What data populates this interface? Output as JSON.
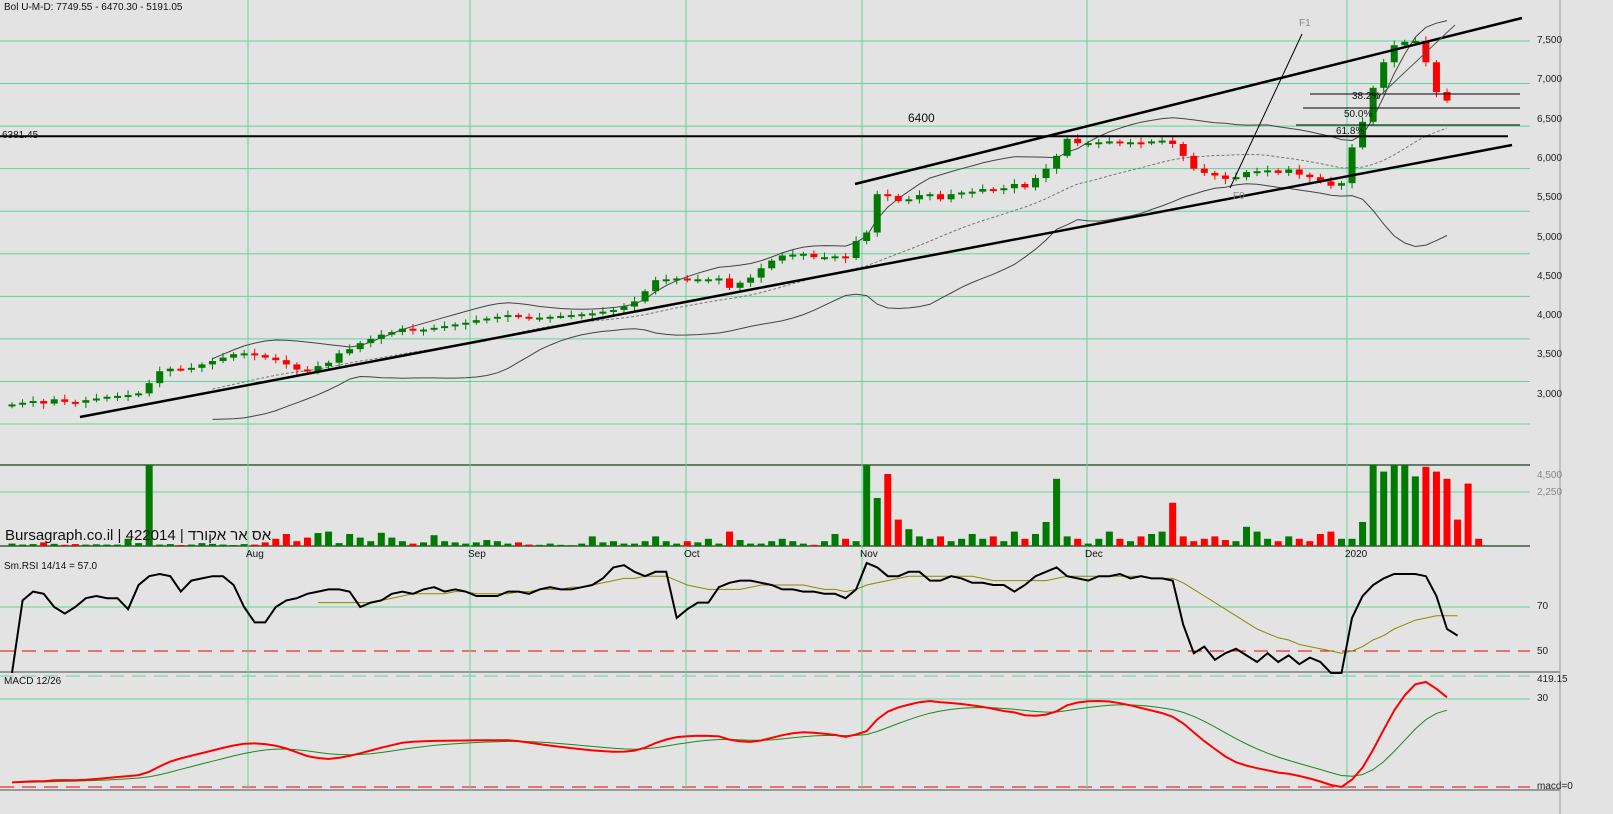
{
  "header": {
    "bollinger_label": "Bol U-M-D: 7749.55 - 6470.30 - 5191.05",
    "level_label": "6381.45"
  },
  "brand": "Bursagraph.co.il | 422014 | אס אר אקורד",
  "annotations": {
    "level": "6400",
    "fib_382": "38.2%",
    "fib_50": "50.0%",
    "fib_618": "61.8%",
    "f1": "F1",
    "f0": "F0"
  },
  "price_axis": [
    "7,500",
    "7,000",
    "6,500",
    "6,000",
    "5,500",
    "5,000",
    "4,500",
    "4,000",
    "3,500",
    "3,000"
  ],
  "volume_axis": [
    "4,500",
    "2,250"
  ],
  "rsi": {
    "label": "Sm.RSI 14/14 = 57.0",
    "axis": [
      "70",
      "50"
    ]
  },
  "macd": {
    "label": "MACD 12/26",
    "axis": [
      "419.15",
      "30",
      "macd=0"
    ]
  },
  "months": [
    "Aug",
    "Sep",
    "Oct",
    "Nov",
    "Dec",
    "2020"
  ],
  "colors": {
    "up": "#007a00",
    "down": "#ff0000",
    "grid": "#5fd49a",
    "bg": "#e3e3e3"
  },
  "chart_data": {
    "type": "candlestick",
    "title": "Bol U-M-D: 7749.55 - 6470.30 - 5191.05",
    "price_ylim": [
      2700,
      7800
    ],
    "horizontal_level": 6381.45,
    "closes": [
      3230,
      3250,
      3270,
      3240,
      3290,
      3260,
      3250,
      3280,
      3300,
      3320,
      3330,
      3340,
      3360,
      3480,
      3620,
      3650,
      3640,
      3660,
      3700,
      3740,
      3780,
      3820,
      3830,
      3810,
      3780,
      3750,
      3700,
      3640,
      3620,
      3680,
      3720,
      3830,
      3880,
      3950,
      4000,
      4050,
      4080,
      4120,
      4100,
      4110,
      4130,
      4150,
      4170,
      4190,
      4220,
      4240,
      4260,
      4280,
      4260,
      4250,
      4250,
      4260,
      4270,
      4280,
      4290,
      4300,
      4320,
      4340,
      4380,
      4440,
      4560,
      4690,
      4700,
      4710,
      4690,
      4700,
      4700,
      4710,
      4600,
      4660,
      4720,
      4830,
      4920,
      4980,
      4990,
      5000,
      4960,
      4960,
      4970,
      4950,
      5150,
      5250,
      5700,
      5680,
      5620,
      5640,
      5690,
      5700,
      5640,
      5700,
      5720,
      5730,
      5760,
      5750,
      5770,
      5820,
      5780,
      5890,
      6000,
      6150,
      6350,
      6300,
      6300,
      6310,
      6320,
      6300,
      6310,
      6300,
      6320,
      6330,
      6290,
      6150,
      6000,
      5950,
      5920,
      5880,
      5900,
      5960,
      5970,
      5980,
      5950,
      5990,
      5930,
      5900,
      5850,
      5800,
      5830,
      6250,
      6550,
      6950,
      7250,
      7450,
      7490,
      7500,
      7250,
      6900,
      6800
    ],
    "volumes": [
      100,
      60,
      80,
      150,
      90,
      50,
      80,
      60,
      70,
      60,
      60,
      300,
      120,
      4500,
      60,
      80,
      40,
      60,
      120,
      90,
      60,
      40,
      80,
      60,
      150,
      300,
      500,
      200,
      350,
      540,
      600,
      120,
      500,
      350,
      200,
      550,
      350,
      200,
      100,
      150,
      450,
      200,
      150,
      100,
      150,
      250,
      200,
      100,
      150,
      60,
      50,
      100,
      50,
      30,
      100,
      400,
      150,
      200,
      100,
      100,
      200,
      400,
      200,
      100,
      200,
      150,
      300,
      100,
      600,
      250,
      100,
      100,
      200,
      300,
      200,
      100,
      50,
      200,
      500,
      300,
      200,
      3800,
      2000,
      3000,
      1100,
      700,
      400,
      300,
      400,
      200,
      300,
      500,
      300,
      400,
      200,
      600,
      300,
      500,
      1000,
      2800,
      400,
      300,
      100,
      300,
      600,
      300,
      200,
      400,
      500,
      600,
      1800,
      400,
      200,
      300,
      400,
      250,
      200,
      800,
      600,
      300,
      200,
      400,
      300,
      200,
      500,
      600,
      300,
      300,
      1000,
      3600,
      3100,
      4100,
      4500,
      2900,
      3300,
      3100,
      2800,
      1100,
      2600,
      300
    ],
    "volume_ylim": [
      0,
      4500
    ],
    "rsi_levels": [
      70,
      50
    ],
    "rsi": [
      40,
      73,
      77,
      76,
      70,
      67,
      70,
      74,
      75,
      74,
      74,
      69,
      80,
      84,
      85,
      84,
      77,
      82,
      83,
      84,
      84,
      80,
      70,
      63,
      63,
      70,
      73,
      74,
      76,
      77,
      78,
      78,
      77,
      70,
      72,
      73,
      76,
      77,
      76,
      78,
      79,
      77,
      78,
      77,
      75,
      75,
      75,
      77,
      77,
      76,
      78,
      79,
      78,
      78,
      79,
      80,
      83,
      88,
      89,
      86,
      84,
      86,
      86,
      65,
      69,
      72,
      72,
      79,
      81,
      82,
      82,
      81,
      80,
      78,
      78,
      77,
      77,
      76,
      76,
      74,
      78,
      90,
      88,
      84,
      84,
      86,
      86,
      82,
      82,
      84,
      83,
      81,
      81,
      80,
      80,
      77,
      80,
      84,
      86,
      88,
      84,
      83,
      82,
      84,
      84,
      85,
      83,
      84,
      83,
      83,
      82,
      62,
      49,
      52,
      46,
      49,
      51,
      48,
      45,
      49,
      45,
      48,
      44,
      47,
      45,
      40,
      40,
      65,
      75,
      80,
      83,
      85,
      85,
      85,
      84,
      75,
      60,
      57
    ],
    "rsi_signal": [
      null,
      null,
      null,
      null,
      null,
      null,
      null,
      null,
      null,
      null,
      null,
      null,
      null,
      null,
      null,
      null,
      null,
      null,
      null,
      null,
      null,
      null,
      null,
      null,
      null,
      null,
      null,
      null,
      null,
      72,
      72,
      72,
      72,
      72,
      72,
      73,
      74,
      75,
      76,
      76,
      76,
      76,
      77,
      77,
      76,
      76,
      76,
      76,
      77,
      77,
      78,
      78,
      78,
      79,
      79,
      80,
      81,
      82,
      83,
      83,
      84,
      84,
      84,
      82,
      80,
      79,
      78,
      78,
      78,
      78,
      79,
      80,
      80,
      80,
      80,
      80,
      79,
      78,
      78,
      77,
      78,
      80,
      81,
      82,
      83,
      84,
      84,
      84,
      84,
      84,
      84,
      84,
      83,
      82,
      82,
      82,
      82,
      82,
      82,
      83,
      84,
      84,
      84,
      84,
      84,
      84,
      84,
      84,
      83,
      83,
      83,
      81,
      78,
      75,
      72,
      69,
      66,
      63,
      60,
      58,
      56,
      55,
      53,
      52,
      51,
      50,
      49,
      50,
      52,
      55,
      57,
      60,
      62,
      64,
      65,
      66,
      66,
      66
    ],
    "macd_levels": [
      30,
      0
    ]
  }
}
